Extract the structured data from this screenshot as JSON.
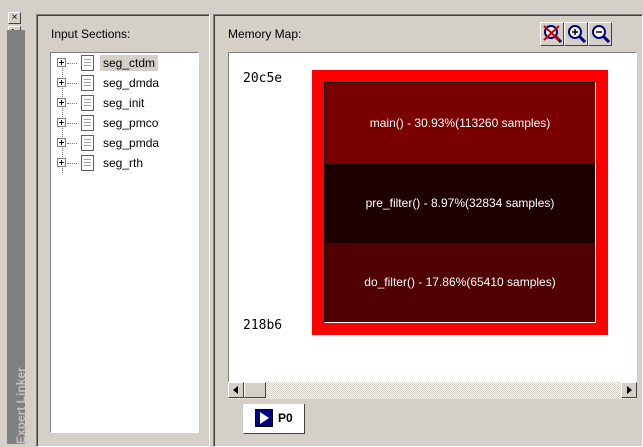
{
  "sidebar": {
    "title": "Expert Linker",
    "close_glyph": "×",
    "pin_glyph": "▸"
  },
  "input_sections": {
    "label": "Input Sections:",
    "items": [
      {
        "label": "seg_ctdm",
        "selected": true
      },
      {
        "label": "seg_dmda",
        "selected": false
      },
      {
        "label": "seg_init",
        "selected": false
      },
      {
        "label": "seg_pmco",
        "selected": false
      },
      {
        "label": "seg_pmda",
        "selected": false
      },
      {
        "label": "seg_rth",
        "selected": false
      }
    ]
  },
  "memory_map": {
    "label": "Memory Map:",
    "toolbar": [
      {
        "name": "zoom-clear-icon"
      },
      {
        "name": "zoom-in-icon"
      },
      {
        "name": "zoom-out-icon"
      }
    ],
    "start_address": "20c5e",
    "end_address": "218b6",
    "segments": [
      {
        "label": "main() - 30.93%(113260 samples)",
        "color": "#7a0000"
      },
      {
        "label": "pre_filter() - 8.97%(32834 samples)",
        "color": "#1f0000"
      },
      {
        "label": "do_filter() - 17.86%(65410 samples)",
        "color": "#500000"
      }
    ],
    "border_color": "#ff0000"
  },
  "tab": {
    "label": "P0",
    "icon": "play-icon"
  }
}
